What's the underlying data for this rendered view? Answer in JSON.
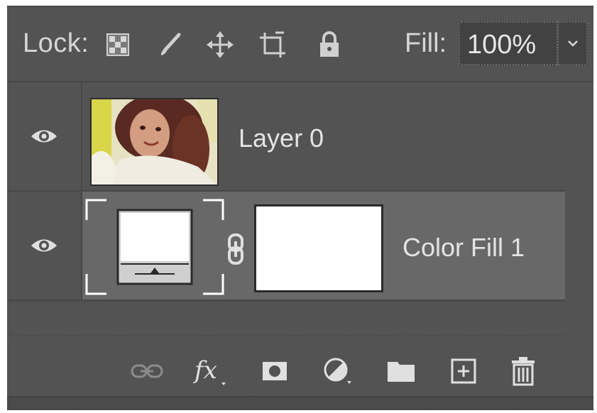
{
  "lock_bar": {
    "lock_label": "Lock:",
    "icons": [
      "lock-transparent-pixels-icon",
      "lock-image-pixels-icon",
      "lock-position-icon",
      "lock-artboard-icon",
      "lock-all-icon"
    ],
    "fill_label": "Fill:",
    "fill_value": "100%"
  },
  "layers": [
    {
      "name": "Layer 0",
      "visible": true,
      "selected": false,
      "kind": "pixel",
      "icon": "photo-thumbnail"
    },
    {
      "name": "Color Fill 1",
      "visible": true,
      "selected": true,
      "kind": "fill",
      "fill_color": "#ffffff",
      "icon": "color-fill-thumbnail"
    }
  ],
  "footer": {
    "buttons": [
      "link-layers-icon",
      "fx-icon",
      "add-mask-icon",
      "adjustment-layer-icon",
      "new-group-icon",
      "new-layer-icon",
      "delete-icon"
    ]
  },
  "colors": {
    "panel_bg": "#535353",
    "selected_row": "#686868",
    "text": "#e4e4e4"
  }
}
